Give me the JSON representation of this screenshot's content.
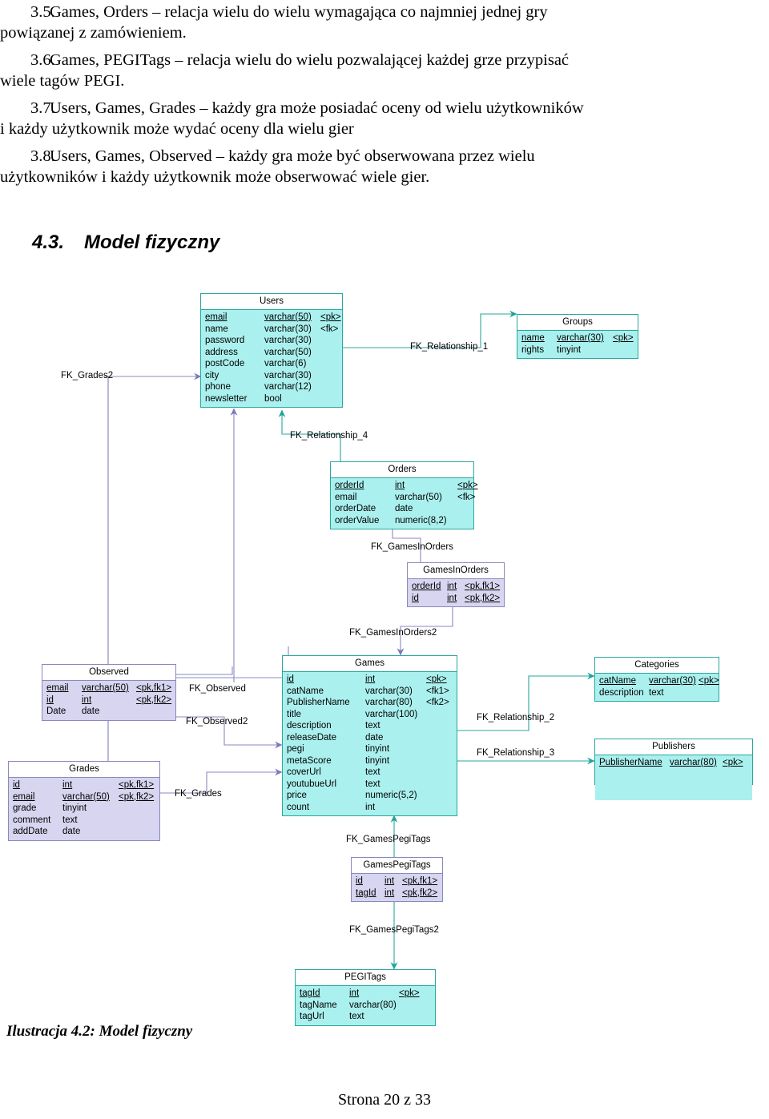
{
  "document": {
    "list_items": [
      {
        "number": "3.5.",
        "line1": "Games, Orders – relacja wielu do wielu wymagająca co najmniej jednej gry",
        "line2": "powiązanej z zamówieniem."
      },
      {
        "number": "3.6.",
        "line1": "Games, PEGITags – relacja wielu do wielu pozwalającej każdej grze przypisać",
        "line2": "wiele tagów PEGI."
      },
      {
        "number": "3.7.",
        "line1": "Users, Games, Grades – każdy gra może posiadać oceny od wielu użytkowników",
        "line2": "i każdy użytkownik może wydać oceny dla wielu gier"
      },
      {
        "number": "3.8.",
        "line1": "Users, Games, Observed – każdy gra może być obserwowana przez wielu",
        "line2": "użytkowników i każdy użytkownik może obserwować wiele gier."
      }
    ],
    "heading": {
      "number": "4.3.",
      "title": "Model fizyczny"
    },
    "caption": "Ilustracja 4.2: Model fizyczny",
    "footer": "Strona 20 z 33"
  },
  "colors": {
    "entity_border_teal": "#2aa79b",
    "entity_fill_teal": "#aaf0ee",
    "entity_border_purple": "#8a88c0",
    "entity_fill_purple": "#d7d5ef",
    "connector_teal": "#2aa79b",
    "connector_purple": "#8a88c0",
    "header_fill": "#ffffff"
  },
  "diagram": {
    "entities": {
      "users": {
        "title": "Users",
        "columns": [
          {
            "name": "email",
            "type": "varchar(50)",
            "key": "<pk>",
            "pk": true
          },
          {
            "name": "name",
            "type": "varchar(30)",
            "key": "<fk>",
            "pk": false
          },
          {
            "name": "password",
            "type": "varchar(30)",
            "key": "",
            "pk": false
          },
          {
            "name": "address",
            "type": "varchar(50)",
            "key": "",
            "pk": false
          },
          {
            "name": "postCode",
            "type": "varchar(6)",
            "key": "",
            "pk": false
          },
          {
            "name": "city",
            "type": "varchar(30)",
            "key": "",
            "pk": false
          },
          {
            "name": "phone",
            "type": "varchar(12)",
            "key": "",
            "pk": false
          },
          {
            "name": "newsletter",
            "type": "bool",
            "key": "",
            "pk": false
          }
        ]
      },
      "groups": {
        "title": "Groups",
        "columns": [
          {
            "name": "name",
            "type": "varchar(30)",
            "key": "<pk>",
            "pk": true
          },
          {
            "name": "rights",
            "type": "tinyint",
            "key": "",
            "pk": false
          }
        ]
      },
      "orders": {
        "title": "Orders",
        "columns": [
          {
            "name": "orderId",
            "type": "int",
            "key": "<pk>",
            "pk": true
          },
          {
            "name": "email",
            "type": "varchar(50)",
            "key": "<fk>",
            "pk": false
          },
          {
            "name": "orderDate",
            "type": "date",
            "key": "",
            "pk": false
          },
          {
            "name": "orderValue",
            "type": "numeric(8,2)",
            "key": "",
            "pk": false
          }
        ]
      },
      "gamesinorders": {
        "title": "GamesInOrders",
        "columns": [
          {
            "name": "orderId",
            "type": "int",
            "key": "<pk,fk1>",
            "pk": true
          },
          {
            "name": "id",
            "type": "int",
            "key": "<pk,fk2>",
            "pk": true
          }
        ]
      },
      "games": {
        "title": "Games",
        "columns": [
          {
            "name": "id",
            "type": "int",
            "key": "<pk>",
            "pk": true
          },
          {
            "name": "catName",
            "type": "varchar(30)",
            "key": "<fk1>",
            "pk": false
          },
          {
            "name": "PublisherName",
            "type": "varchar(80)",
            "key": "<fk2>",
            "pk": false
          },
          {
            "name": "title",
            "type": "varchar(100)",
            "key": "",
            "pk": false
          },
          {
            "name": "description",
            "type": "text",
            "key": "",
            "pk": false
          },
          {
            "name": "releaseDate",
            "type": "date",
            "key": "",
            "pk": false
          },
          {
            "name": "pegi",
            "type": "tinyint",
            "key": "",
            "pk": false
          },
          {
            "name": "metaScore",
            "type": "tinyint",
            "key": "",
            "pk": false
          },
          {
            "name": "coverUrl",
            "type": "text",
            "key": "",
            "pk": false
          },
          {
            "name": "youtubueUrl",
            "type": "text",
            "key": "",
            "pk": false
          },
          {
            "name": "price",
            "type": "numeric(5,2)",
            "key": "",
            "pk": false
          },
          {
            "name": "count",
            "type": "int",
            "key": "",
            "pk": false
          }
        ]
      },
      "observed": {
        "title": "Observed",
        "columns": [
          {
            "name": "email",
            "type": "varchar(50)",
            "key": "<pk,fk1>",
            "pk": true
          },
          {
            "name": "id",
            "type": "int",
            "key": "<pk,fk2>",
            "pk": true
          },
          {
            "name": "Date",
            "type": "date",
            "key": "",
            "pk": false
          }
        ]
      },
      "grades": {
        "title": "Grades",
        "columns": [
          {
            "name": "id",
            "type": "int",
            "key": "<pk,fk1>",
            "pk": true
          },
          {
            "name": "email",
            "type": "varchar(50)",
            "key": "<pk,fk2>",
            "pk": true
          },
          {
            "name": "grade",
            "type": "tinyint",
            "key": "",
            "pk": false
          },
          {
            "name": "comment",
            "type": "text",
            "key": "",
            "pk": false
          },
          {
            "name": "addDate",
            "type": "date",
            "key": "",
            "pk": false
          }
        ]
      },
      "categories": {
        "title": "Categories",
        "columns": [
          {
            "name": "catName",
            "type": "varchar(30)",
            "key": "<pk>",
            "pk": true
          },
          {
            "name": "description",
            "type": "text",
            "key": "",
            "pk": false
          }
        ]
      },
      "publishers": {
        "title": "Publishers",
        "columns": [
          {
            "name": "PublisherName",
            "type": "varchar(80)",
            "key": "<pk>",
            "pk": true
          }
        ]
      },
      "gamespegitags": {
        "title": "GamesPegiTags",
        "columns": [
          {
            "name": "id",
            "type": "int",
            "key": "<pk,fk1>",
            "pk": true
          },
          {
            "name": "tagId",
            "type": "int",
            "key": "<pk,fk2>",
            "pk": true
          }
        ]
      },
      "pegitags": {
        "title": "PEGITags",
        "columns": [
          {
            "name": "tagId",
            "type": "int",
            "key": "<pk>",
            "pk": true
          },
          {
            "name": "tagName",
            "type": "varchar(80)",
            "key": "",
            "pk": false
          },
          {
            "name": "tagUrl",
            "type": "text",
            "key": "",
            "pk": false
          }
        ]
      }
    },
    "relationships": [
      {
        "id": "fk_grades2",
        "label": "FK_Grades2"
      },
      {
        "id": "fk_relationship_1",
        "label": "FK_Relationship_1"
      },
      {
        "id": "fk_relationship_4",
        "label": "FK_Relationship_4"
      },
      {
        "id": "fk_gamesinorders",
        "label": "FK_GamesInOrders"
      },
      {
        "id": "fk_gamesinorders2",
        "label": "FK_GamesInOrders2"
      },
      {
        "id": "fk_observed",
        "label": "FK_Observed"
      },
      {
        "id": "fk_observed2",
        "label": "FK_Observed2"
      },
      {
        "id": "fk_grades",
        "label": "FK_Grades"
      },
      {
        "id": "fk_relationship_2",
        "label": "FK_Relationship_2"
      },
      {
        "id": "fk_relationship_3",
        "label": "FK_Relationship_3"
      },
      {
        "id": "fk_gamespegitags",
        "label": "FK_GamesPegiTags"
      },
      {
        "id": "fk_gamespegitags2",
        "label": "FK_GamesPegiTags2"
      }
    ]
  }
}
